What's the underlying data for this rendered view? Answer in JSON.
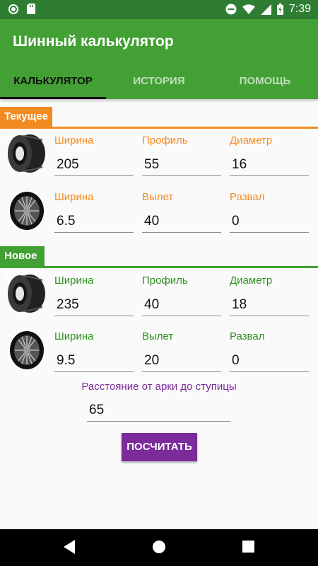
{
  "status_bar": {
    "time": "7:39",
    "icons": [
      "notification-icon",
      "sd-card-icon",
      "do-not-disturb-icon",
      "wifi-icon",
      "signal-icon",
      "battery-icon"
    ]
  },
  "app": {
    "title": "Шинный калькулятор",
    "primary_color": "#43a035",
    "dark_color": "#2e7d32",
    "accent_color": "#7b2b9a"
  },
  "tabs": [
    {
      "label": "КАЛЬКУЛЯТОР",
      "active": true
    },
    {
      "label": "ИСТОРИЯ",
      "active": false
    },
    {
      "label": "ПОМОЩЬ",
      "active": false
    }
  ],
  "current_wheel": {
    "title": "Текущее колесо",
    "color": "#f28a22",
    "tire": {
      "width_label": "Ширина",
      "width_value": "205",
      "profile_label": "Профиль",
      "profile_value": "55",
      "diameter_label": "Диаметр",
      "diameter_value": "16"
    },
    "rim": {
      "width_label": "Ширина",
      "width_value": "6.5",
      "offset_label": "Вылет",
      "offset_value": "40",
      "camber_label": "Развал",
      "camber_value": "0"
    }
  },
  "new_wheel": {
    "title": "Новое колесо",
    "color": "#2e8f1f",
    "tire": {
      "width_label": "Ширина",
      "width_value": "235",
      "profile_label": "Профиль",
      "profile_value": "40",
      "diameter_label": "Диаметр",
      "diameter_value": "18"
    },
    "rim": {
      "width_label": "Ширина",
      "width_value": "9.5",
      "offset_label": "Вылет",
      "offset_value": "20",
      "camber_label": "Развал",
      "camber_value": "0"
    }
  },
  "distance": {
    "label": "Расстояние от арки до ступицы",
    "value": "65"
  },
  "calculate_button": {
    "label": "ПОСЧИТАТЬ"
  },
  "nav_bar": {
    "icons": [
      "back-icon",
      "home-icon",
      "recents-icon"
    ]
  }
}
